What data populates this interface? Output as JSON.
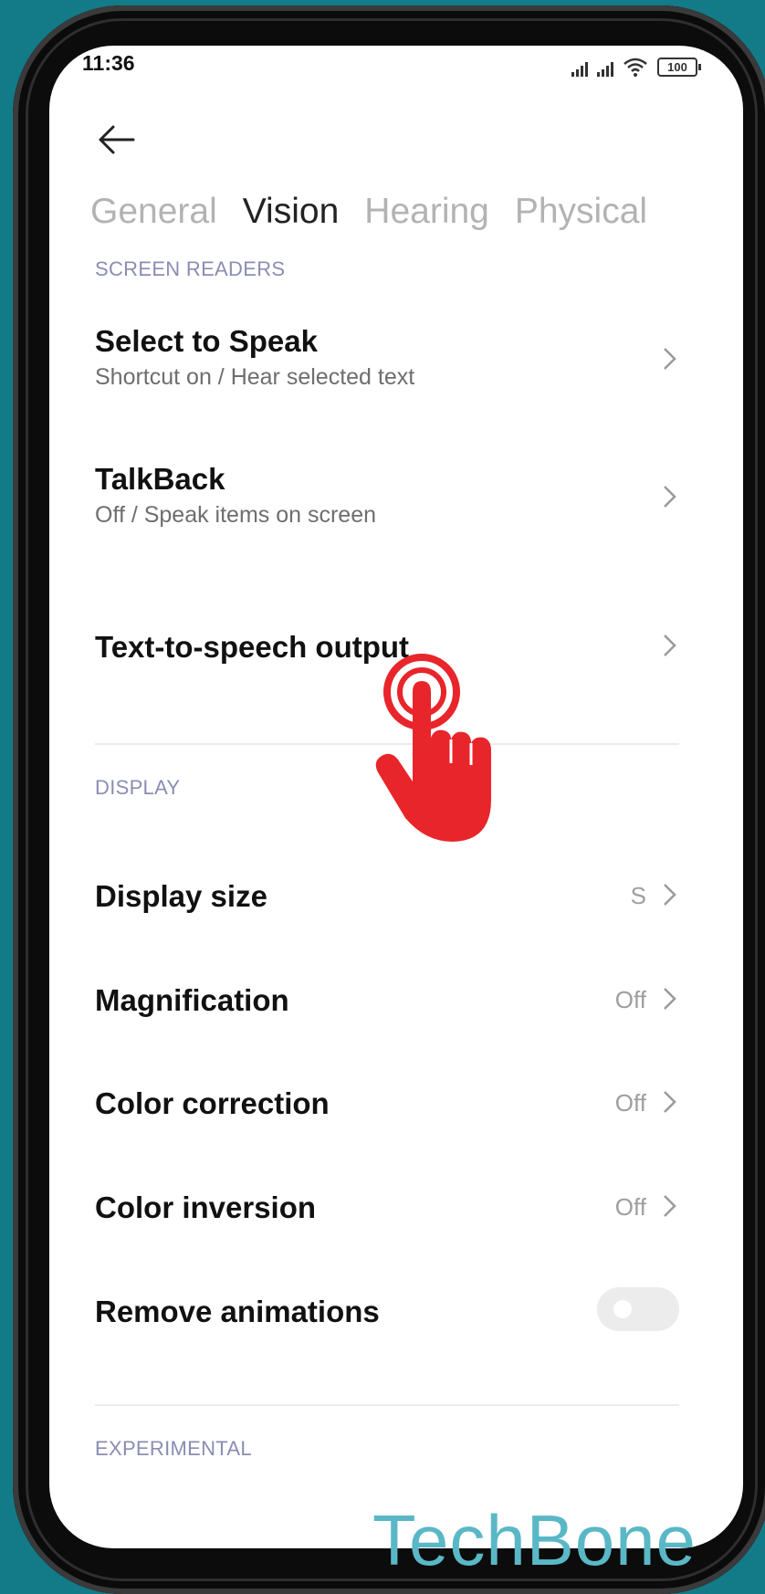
{
  "status": {
    "time": "11:36",
    "battery": "100"
  },
  "tabs": [
    "General",
    "Vision",
    "Hearing",
    "Physical"
  ],
  "sections": {
    "screen_readers": "SCREEN READERS",
    "display": "DISPLAY",
    "experimental": "EXPERIMENTAL"
  },
  "items": {
    "select_to_speak": {
      "title": "Select to Speak",
      "subtitle": "Shortcut on / Hear selected text"
    },
    "talkback": {
      "title": "TalkBack",
      "subtitle": "Off / Speak items on screen"
    },
    "tts": {
      "title": "Text-to-speech output"
    },
    "display_size": {
      "title": "Display size",
      "value": "S"
    },
    "magnification": {
      "title": "Magnification",
      "value": "Off"
    },
    "color_correction": {
      "title": "Color correction",
      "value": "Off"
    },
    "color_inversion": {
      "title": "Color inversion",
      "value": "Off"
    },
    "remove_animations": {
      "title": "Remove animations",
      "toggle": "off"
    }
  },
  "watermark": "TechBone",
  "colors": {
    "accent_hand": "#e8252a",
    "section_header": "#8a8db3",
    "background": "#137a88"
  },
  "icons": [
    "back-arrow-icon",
    "chevron-right-icon",
    "tap-hand-icon",
    "wifi-icon",
    "signal-icon",
    "battery-icon"
  ]
}
